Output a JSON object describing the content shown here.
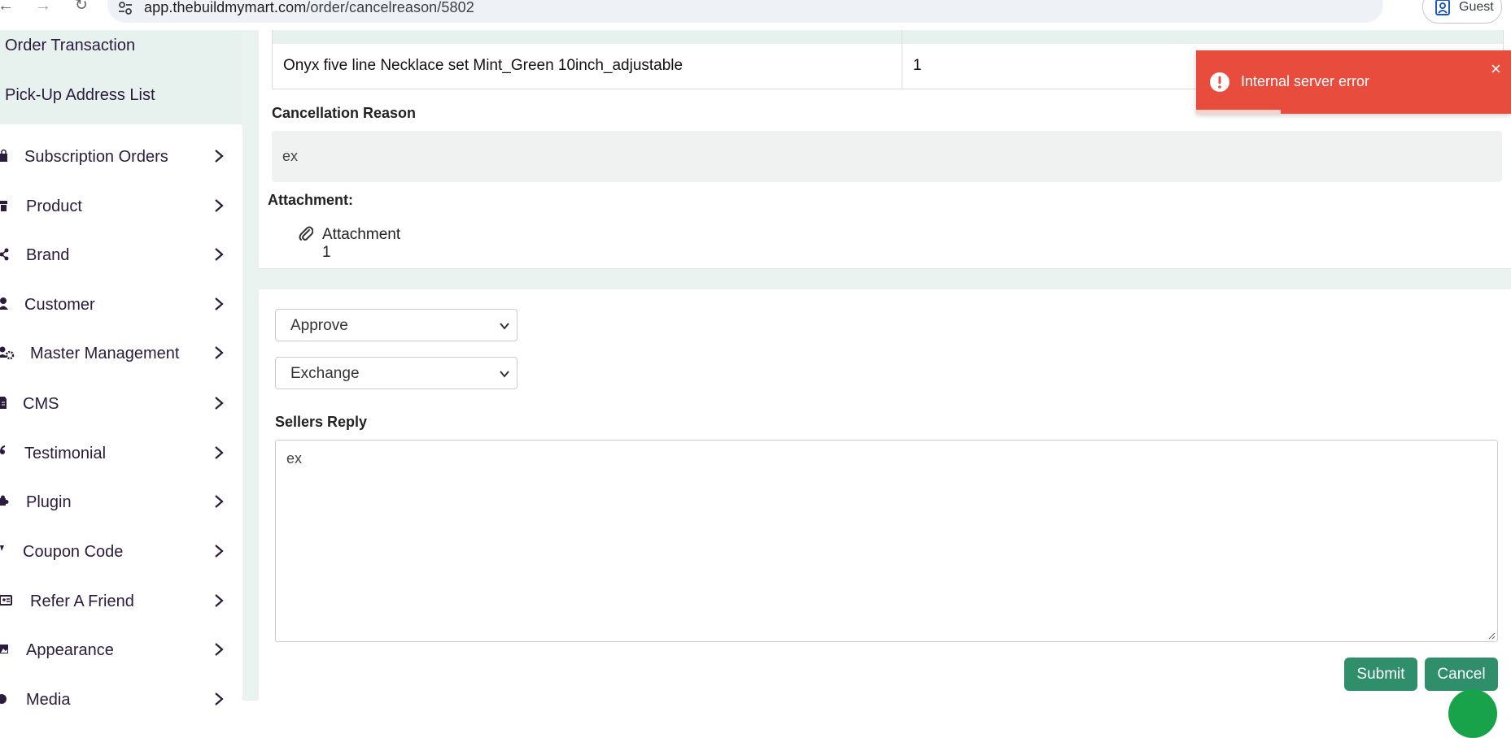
{
  "browser": {
    "url_host": "app.thebuildmymart.com",
    "url_path": "/order/cancelreason/5802",
    "profile_label": "Guest"
  },
  "sidebar": {
    "sub_links": [
      "Order Transaction",
      "Pick-Up Address List"
    ],
    "items": [
      {
        "label": "Subscription Orders",
        "icon": "bag-icon"
      },
      {
        "label": "Product",
        "icon": "box-icon"
      },
      {
        "label": "Brand",
        "icon": "share-icon"
      },
      {
        "label": "Customer",
        "icon": "user-icon"
      },
      {
        "label": "Master Management",
        "icon": "users-gear-icon"
      },
      {
        "label": "CMS",
        "icon": "document-icon"
      },
      {
        "label": "Testimonial",
        "icon": "quote-icon"
      },
      {
        "label": "Plugin",
        "icon": "puzzle-icon"
      },
      {
        "label": "Coupon Code",
        "icon": "tag-icon"
      },
      {
        "label": "Refer A Friend",
        "icon": "id-card-icon"
      },
      {
        "label": "Appearance",
        "icon": "image-icon"
      },
      {
        "label": "Media",
        "icon": "play-icon"
      }
    ]
  },
  "order_items": [
    {
      "product": "Onyx five line Necklace set Mint_Green 10inch_adjustable",
      "quantity": "1"
    }
  ],
  "cancellation": {
    "label": "Cancellation Reason",
    "reason": "ex",
    "attachment_label": "Attachment:",
    "attachment_link": "Attachment 1"
  },
  "response_form": {
    "action_selected": "Approve",
    "type_selected": "Exchange",
    "reply_label": "Sellers Reply",
    "reply_value": "ex",
    "submit_label": "Submit",
    "cancel_label": "Cancel"
  },
  "toast": {
    "message": "Internal server error",
    "close": "×",
    "progress": 0.27
  },
  "colors": {
    "accent": "#2f8f6a",
    "sidebar_highlight": "#e7f1ee",
    "toast_error": "#e74c3c",
    "sidebar_text": "#2b1b3d"
  }
}
